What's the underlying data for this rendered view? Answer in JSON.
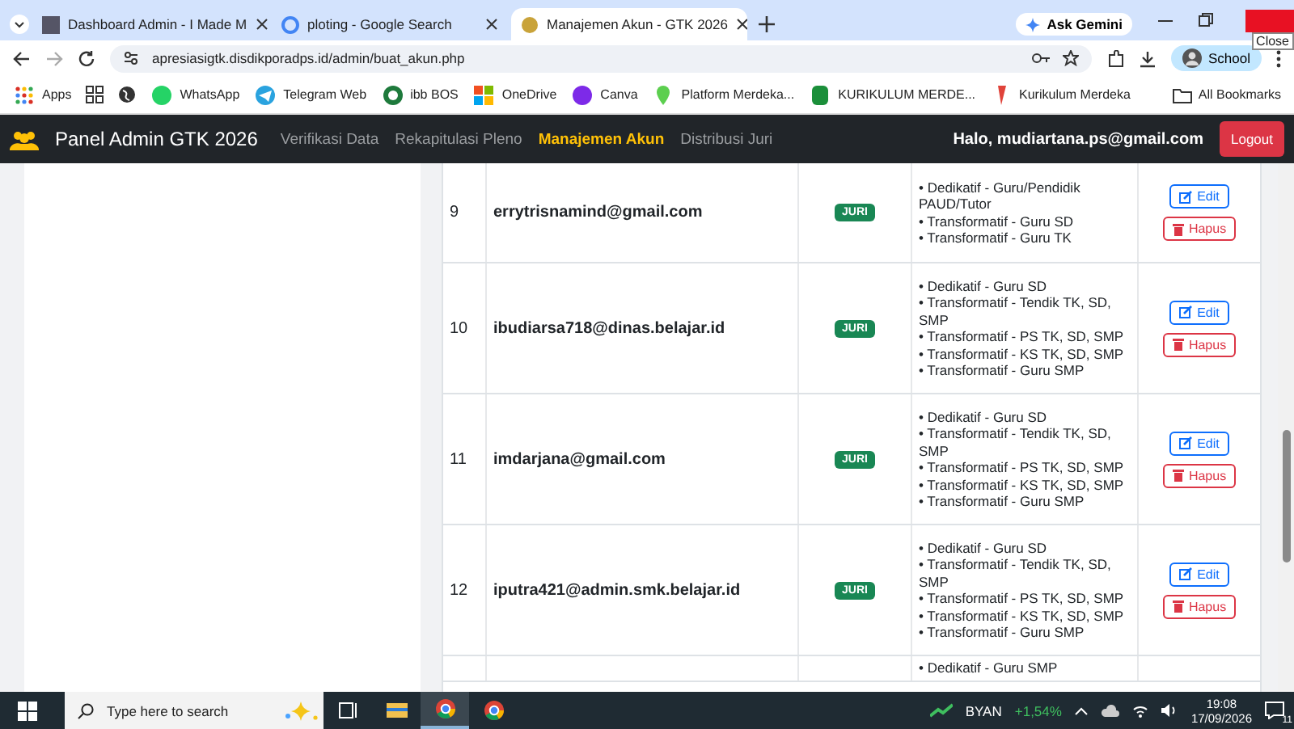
{
  "browser": {
    "tabs": [
      {
        "title": "Dashboard Admin - I Made M",
        "selected": false
      },
      {
        "title": "ploting - Google Search",
        "selected": false
      },
      {
        "title": "Manajemen Akun - GTK 2026",
        "selected": true
      }
    ],
    "ask_button": "Ask Gemini",
    "close_tooltip": "Close",
    "url": "apresiasigtk.disdikporadps.id/admin/buat_akun.php",
    "profile": "School",
    "bookmarks": [
      {
        "label": "Apps",
        "kind": "apps"
      },
      {
        "label": "WhatsApp",
        "kind": "whatsapp"
      },
      {
        "label": "Telegram Web",
        "kind": "telegram"
      },
      {
        "label": "ibb BOS",
        "kind": "ibb"
      },
      {
        "label": "OneDrive",
        "kind": "onedrive"
      },
      {
        "label": "Canva",
        "kind": "canva"
      },
      {
        "label": "Platform Merdeka...",
        "kind": "platform"
      },
      {
        "label": "KURIKULUM MERDE...",
        "kind": "kurikulum"
      },
      {
        "label": "Kurikulum Merdeka",
        "kind": "doc"
      }
    ],
    "all_bookmarks": "All Bookmarks"
  },
  "navbar": {
    "brand": "Panel Admin GTK 2026",
    "links": [
      {
        "label": "Verifikasi Data",
        "selected": false
      },
      {
        "label": "Rekapitulasi Pleno",
        "selected": false
      },
      {
        "label": "Manajemen Akun",
        "selected": true
      },
      {
        "label": "Distribusi Juri",
        "selected": false
      }
    ],
    "greeting": "Halo, mudiartana.ps@gmail.com",
    "logout": "Logout"
  },
  "table": {
    "rows": [
      {
        "no": "9",
        "email": "errytrisnamind@gmail.com",
        "role": "JURI",
        "categories": [
          "• Dedikatif - Guru/Pendidik PAUD/Tutor",
          "• Transformatif - Guru SD",
          "• Transformatif - Guru TK"
        ],
        "edit": "Edit",
        "delete": "Hapus"
      },
      {
        "no": "10",
        "email": "ibudiarsa718@dinas.belajar.id",
        "role": "JURI",
        "categories": [
          "• Dedikatif - Guru SD",
          "• Transformatif - Tendik TK, SD, SMP",
          "• Transformatif - PS TK, SD, SMP",
          "• Transformatif - KS TK, SD, SMP",
          "• Transformatif - Guru SMP"
        ],
        "edit": "Edit",
        "delete": "Hapus"
      },
      {
        "no": "11",
        "email": "imdarjana@gmail.com",
        "role": "JURI",
        "categories": [
          "• Dedikatif - Guru SD",
          "• Transformatif - Tendik TK, SD, SMP",
          "• Transformatif - PS TK, SD, SMP",
          "• Transformatif - KS TK, SD, SMP",
          "• Transformatif - Guru SMP"
        ],
        "edit": "Edit",
        "delete": "Hapus"
      },
      {
        "no": "12",
        "email": "iputra421@admin.smk.belajar.id",
        "role": "JURI",
        "categories": [
          "• Dedikatif - Guru SD",
          "• Transformatif - Tendik TK, SD, SMP",
          "• Transformatif - PS TK, SD, SMP",
          "• Transformatif - KS TK, SD, SMP",
          "• Transformatif - Guru SMP"
        ],
        "edit": "Edit",
        "delete": "Hapus"
      },
      {
        "categories": [
          "• Dedikatif - Guru SMP"
        ]
      }
    ]
  },
  "taskbar": {
    "search_placeholder": "Type here to search",
    "apps": [
      {
        "kind": "taskview",
        "selected": false
      },
      {
        "kind": "explorer",
        "selected": false
      },
      {
        "kind": "chrome-profile",
        "selected": true
      },
      {
        "kind": "chrome",
        "selected": false
      }
    ],
    "stock": {
      "symbol": "BYAN",
      "change": "+1,54%"
    },
    "time": "19:08",
    "date": "17/09/2026",
    "notifications": "11"
  }
}
